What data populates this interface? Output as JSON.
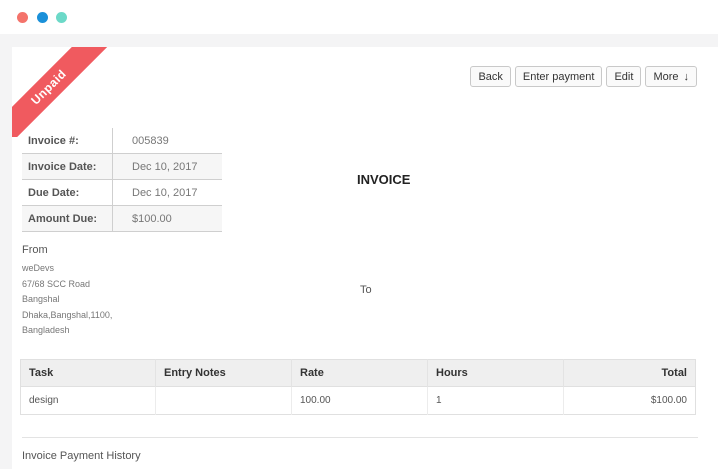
{
  "window": {
    "dots": [
      {
        "color": "#f4736b",
        "name": "close"
      },
      {
        "color": "#1a90d9",
        "name": "minimize"
      },
      {
        "color": "#6cd9c8",
        "name": "maximize"
      }
    ]
  },
  "ribbon": {
    "label": "Unpaid",
    "color": "#f05a5f"
  },
  "actions": {
    "back": "Back",
    "enter_payment": "Enter payment",
    "edit": "Edit",
    "more": "More",
    "more_icon": "arrow-down-icon"
  },
  "meta": [
    {
      "label": "Invoice #:",
      "value": "005839"
    },
    {
      "label": "Invoice Date:",
      "value": "Dec 10, 2017"
    },
    {
      "label": "Due Date:",
      "value": "Dec 10, 2017"
    },
    {
      "label": "Amount Due:",
      "value": "$100.00"
    }
  ],
  "title": "INVOICE",
  "from": {
    "heading": "From",
    "lines": [
      "weDevs",
      "67/68 SCC Road",
      "Bangshal",
      "Dhaka,Bangshal,1100,",
      "Bangladesh"
    ]
  },
  "to": {
    "heading": "To"
  },
  "items": {
    "columns": [
      "Task",
      "Entry Notes",
      "Rate",
      "Hours",
      "Total"
    ],
    "rows": [
      [
        "design",
        "",
        "100.00",
        "1",
        "$100.00"
      ]
    ]
  },
  "history": {
    "heading": "Invoice Payment History"
  }
}
